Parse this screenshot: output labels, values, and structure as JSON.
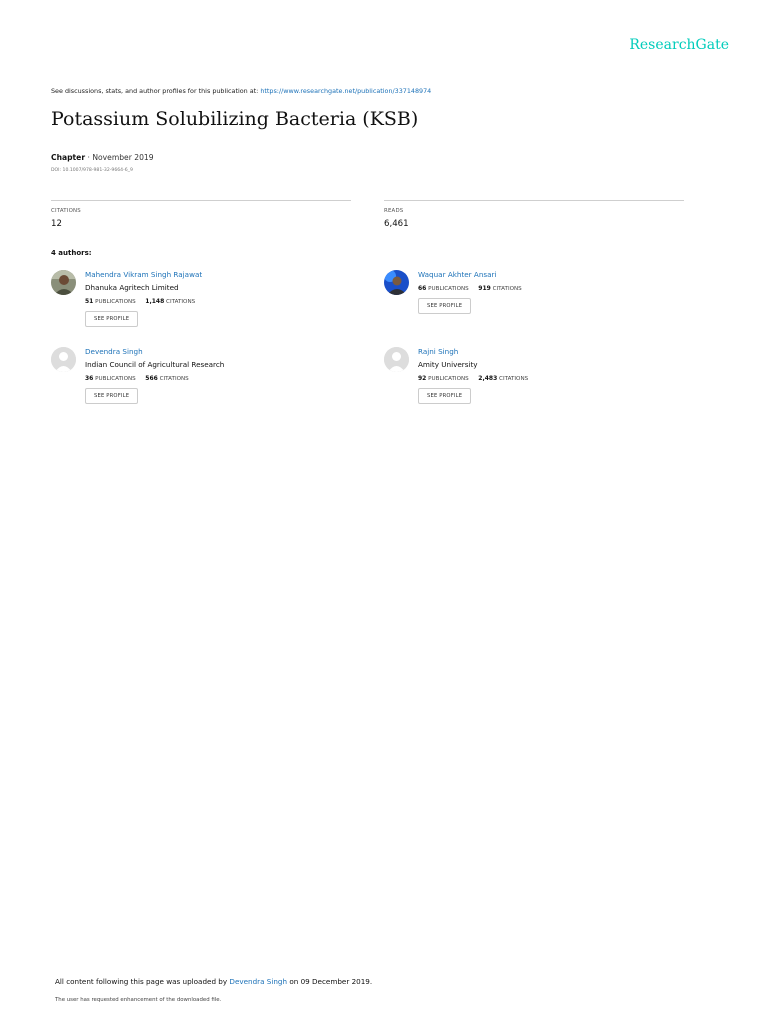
{
  "brand": {
    "logo": "ResearchGate"
  },
  "header": {
    "discussion_text": "See discussions, stats, and author profiles for this publication at:",
    "publication_url": "https://www.researchgate.net/publication/337148974"
  },
  "publication": {
    "title": "Potassium Solubilizing Bacteria (KSB)",
    "type": "Chapter",
    "date_text": "· November 2019",
    "doi": "DOI: 10.1007/978-981-32-9664-6_9"
  },
  "stats": {
    "citations_label": "CITATIONS",
    "citations_value": "12",
    "reads_label": "READS",
    "reads_value": "6,461"
  },
  "authors_heading": "4 authors:",
  "stat_labels": {
    "publications": "PUBLICATIONS",
    "citations": "CITATIONS"
  },
  "see_profile_label": "SEE PROFILE",
  "authors": [
    {
      "name": "Mahendra Vikram Singh Rajawat",
      "institution": "Dhanuka Agritech Limited",
      "publications": "51",
      "citations": "1,148"
    },
    {
      "name": "Waquar Akhter Ansari",
      "institution": "",
      "publications": "66",
      "citations": "919"
    },
    {
      "name": "Devendra Singh",
      "institution": "Indian Council of Agricultural Research",
      "publications": "36",
      "citations": "566"
    },
    {
      "name": "Rajni Singh",
      "institution": "Amity University",
      "publications": "92",
      "citations": "2,483"
    }
  ],
  "footer": {
    "uploaded_prefix": "All content following this page was uploaded by",
    "uploader": "Devendra Singh",
    "uploaded_suffix": "on 09 December 2019.",
    "note": "The user has requested enhancement of the downloaded file."
  },
  "colors": {
    "brand": "#00ccbb",
    "link": "#1d72b8"
  }
}
